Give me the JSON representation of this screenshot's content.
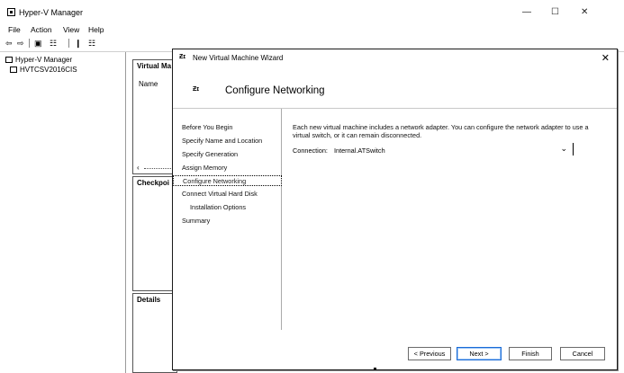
{
  "window": {
    "title": "Hyper-V Manager",
    "controls": {
      "minimize": "—",
      "maximize": "☐",
      "close": "✕"
    }
  },
  "menu": [
    "File",
    "Action",
    "View",
    "Help"
  ],
  "toolbar": {
    "back_icon": "⇦",
    "forward_icon": "⇨",
    "up_icon": "▣",
    "show_scope_icon": "☷",
    "help_icon": "❙",
    "properties_icon": "☷"
  },
  "tree": {
    "root": "Hyper-V Manager",
    "server": "HVTCSV2016CIS"
  },
  "panes": {
    "virtual_machines": "Virtual Ma",
    "name_column": "Name",
    "checkpoints": "Checkpoi",
    "details": "Details"
  },
  "dialog": {
    "title": "New Virtual Machine Wizard",
    "heading": "Configure Networking",
    "steps": [
      "Before You Begin",
      "Specify Name and Location",
      "Specify Generation",
      "Assign Memory",
      "Configure Networking",
      "Connect Virtual Hard Disk",
      "Installation Options",
      "Summary"
    ],
    "description": "Each new virtual machine includes a network adapter. You can configure the network adapter to use a virtual switch, or it can remain disconnected.",
    "connection_label": "Connection:",
    "connection_value": "Internal.ATSwitch",
    "buttons": {
      "previous": "< Previous",
      "next": "Next >",
      "finish": "Finish",
      "cancel": "Cancel"
    }
  }
}
